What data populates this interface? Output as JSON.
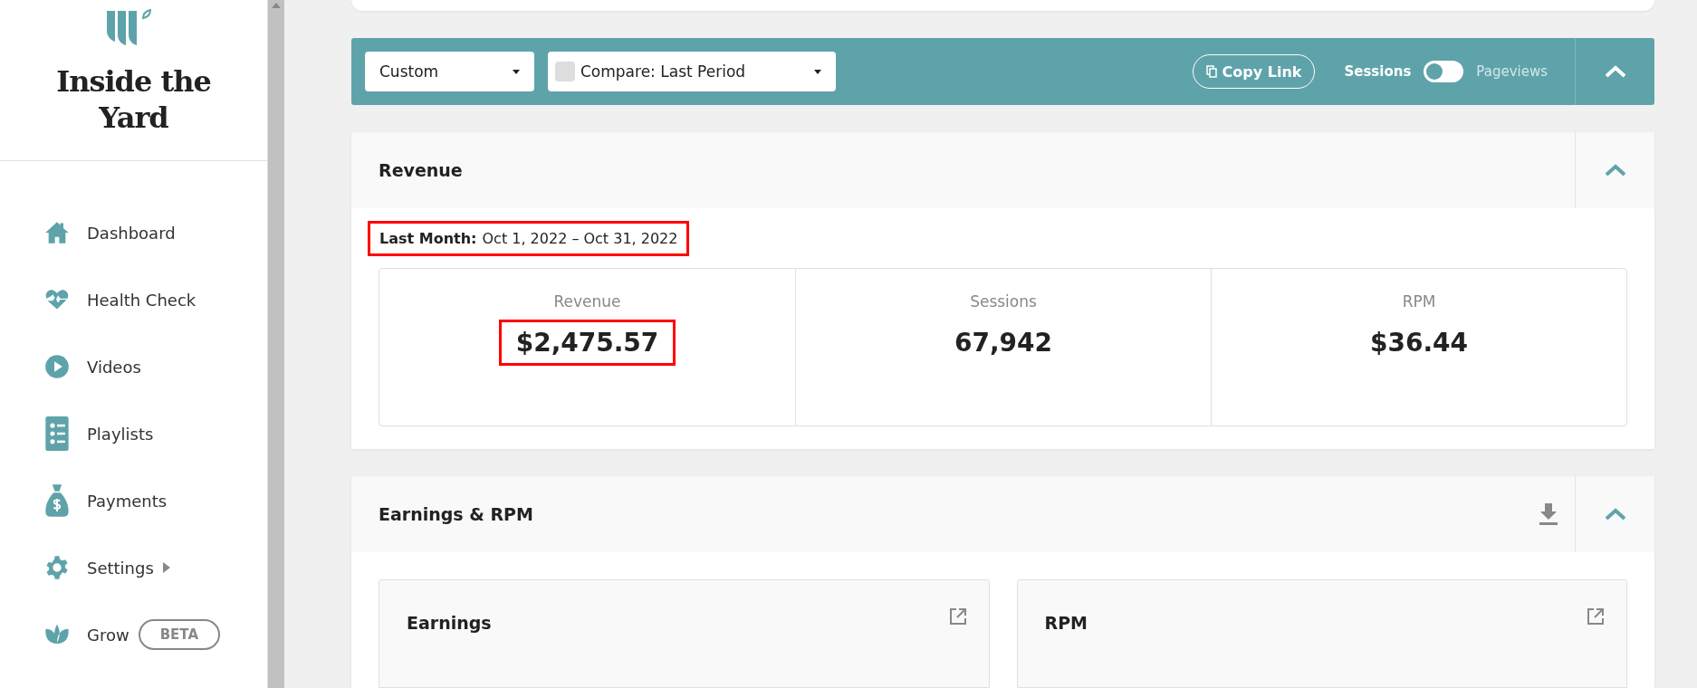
{
  "sidebar": {
    "title": "Inside the Yard",
    "items": [
      {
        "label": "Dashboard",
        "kind": "home",
        "submenu": false
      },
      {
        "label": "Health Check",
        "kind": "health",
        "submenu": false
      },
      {
        "label": "Videos",
        "kind": "videos",
        "submenu": false
      },
      {
        "label": "Playlists",
        "kind": "playlists",
        "submenu": false
      },
      {
        "label": "Payments",
        "kind": "payments",
        "submenu": false
      },
      {
        "label": "Settings",
        "kind": "settings",
        "submenu": true
      },
      {
        "label": "Grow",
        "kind": "grow",
        "submenu": false,
        "badge": "BETA"
      }
    ]
  },
  "toolbar": {
    "period_dropdown": {
      "value": "Custom"
    },
    "compare_dropdown": {
      "value": "Compare: Last Period",
      "checked": false
    },
    "copy_link": "Copy Link",
    "metric_toggle": [
      {
        "label": "Sessions",
        "selected": true
      },
      {
        "label": "Pageviews",
        "selected": false
      }
    ]
  },
  "revenue_section": {
    "title": "Revenue",
    "expanded": true,
    "period_label": "Last Month:",
    "period_range": "Oct 1, 2022 – Oct 31, 2022",
    "period_highlighted": true,
    "stats": [
      {
        "label": "Revenue",
        "value": "$2,475.57",
        "highlighted": true
      },
      {
        "label": "Sessions",
        "value": "67,942",
        "highlighted": false
      },
      {
        "label": "RPM",
        "value": "$36.44",
        "highlighted": false
      }
    ]
  },
  "earnings_section": {
    "title": "Earnings & RPM",
    "expanded": true,
    "panels": [
      {
        "title": "Earnings"
      },
      {
        "title": "RPM"
      }
    ]
  }
}
